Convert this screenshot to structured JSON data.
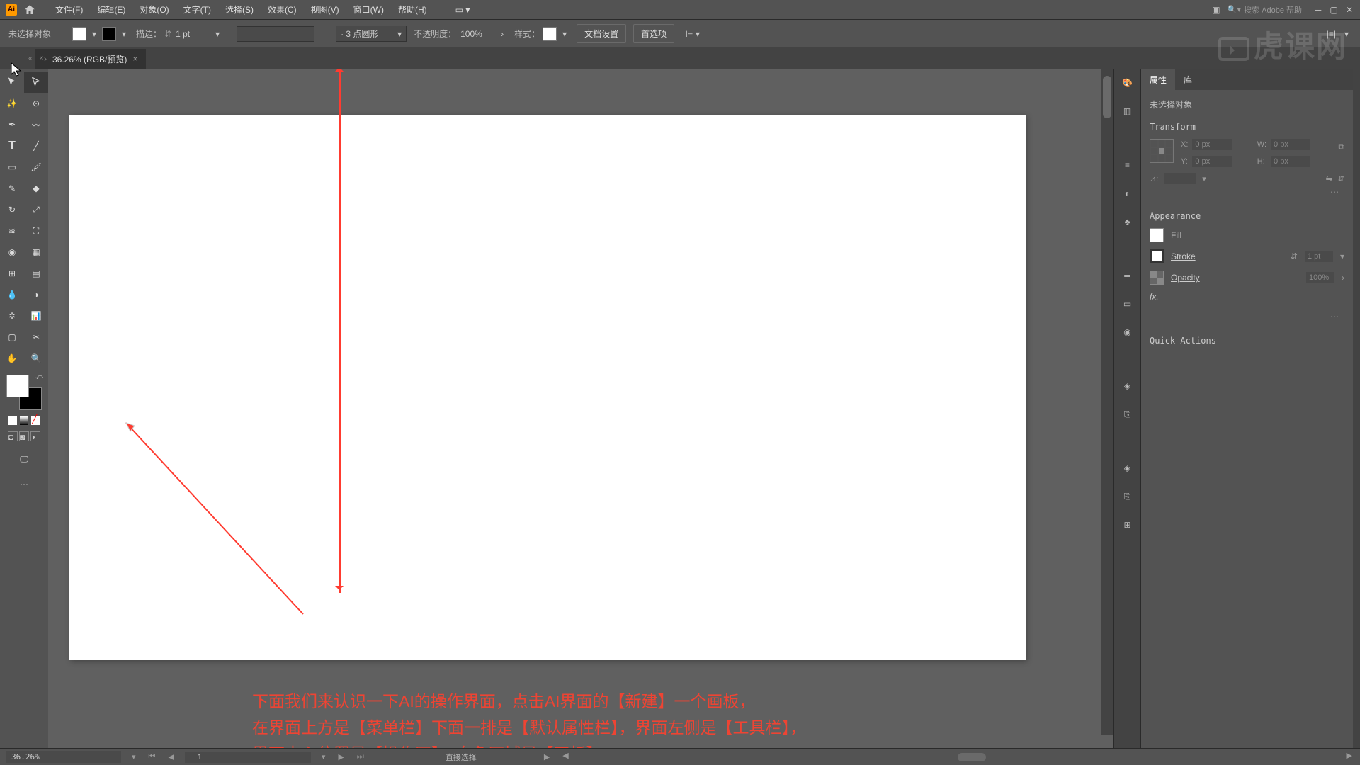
{
  "menubar": {
    "items": [
      "文件(F)",
      "编辑(E)",
      "对象(O)",
      "文字(T)",
      "选择(S)",
      "效果(C)",
      "视图(V)",
      "窗口(W)",
      "帮助(H)"
    ],
    "search_placeholder": "搜索 Adobe 帮助"
  },
  "controlbar": {
    "no_selection": "未选择对象",
    "stroke_label": "描边：",
    "stroke_value": "1 pt",
    "profile_label": "· 3 点圆形",
    "opacity_label": "不透明度：",
    "opacity_value": "100%",
    "style_label": "样式：",
    "doc_setup": "文档设置",
    "prefs": "首选项"
  },
  "doctab": {
    "title": "36.26% (RGB/预览)",
    "close": "×"
  },
  "annotation": {
    "line1": "下面我们来认识一下AI的操作界面，点击AI界面的【新建】一个画板，",
    "line2": "在界面上方是【菜单栏】下面一排是【默认属性栏】，界面左侧是【工具栏】，",
    "line3": "界面中心位置是【操作区】，白色区域是【画板】"
  },
  "props": {
    "tabs": [
      "属性",
      "库"
    ],
    "no_sel": "未选择对象",
    "transform_title": "Transform",
    "labels": {
      "x": "X:",
      "y": "Y:",
      "w": "W:",
      "h": "H:",
      "angle": "⊿:"
    },
    "vals": {
      "x": "0 px",
      "y": "0 px",
      "w": "0 px",
      "h": "0 px"
    },
    "appearance_title": "Appearance",
    "fill_label": "Fill",
    "stroke_label": "Stroke",
    "stroke_val": "1 pt",
    "opacity_label": "Opacity",
    "opacity_val": "100%",
    "fx_label": "fx.",
    "quick_actions": "Quick Actions"
  },
  "statusbar": {
    "zoom": "36.26%",
    "page": "1",
    "tool": "直接选择"
  },
  "watermark": "虎课网"
}
